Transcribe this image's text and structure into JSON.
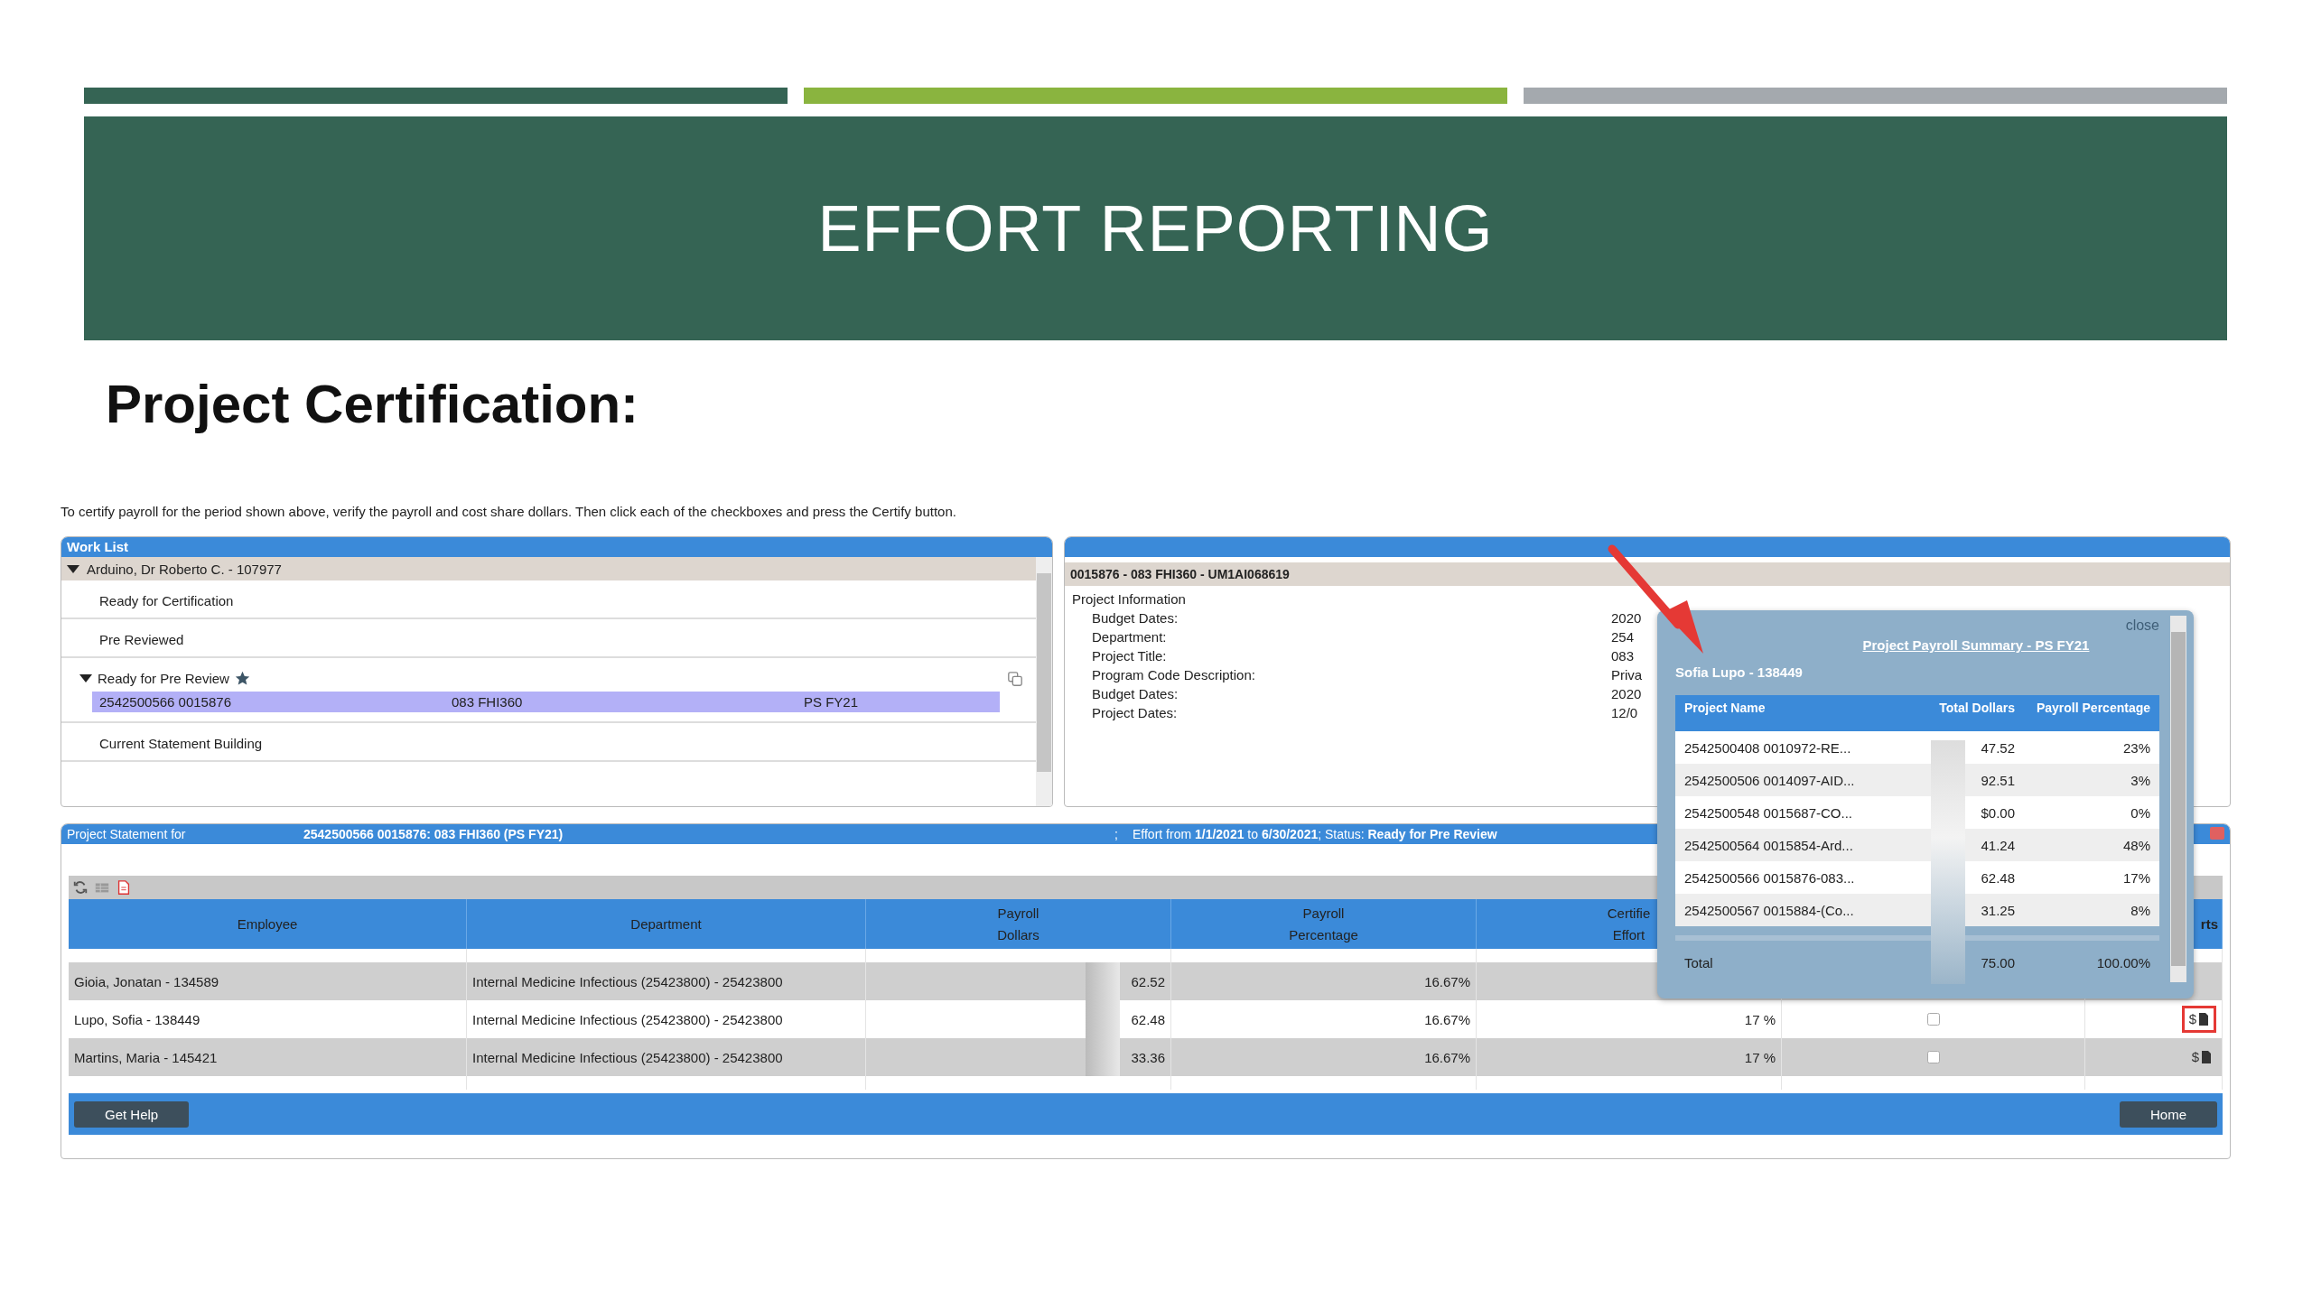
{
  "slide": {
    "title": "EFFORT REPORTING",
    "heading": "Project Certification:"
  },
  "accent_bars": [
    {
      "color": "#356454"
    },
    {
      "color": "#8ab43f"
    },
    {
      "color": "#a4a9ae"
    }
  ],
  "instructions": "To certify payroll for the period shown above, verify the payroll and cost share dollars. Then click each of the checkboxes and press the Certify button.",
  "work_list": {
    "title": "Work List",
    "tree": [
      {
        "label": "Arduino, Dr Roberto C. - 107977",
        "expanded": true,
        "children": [
          {
            "label": "Ready for Certification",
            "expanded": false,
            "starred": false
          },
          {
            "label": "Pre Reviewed",
            "expanded": false,
            "starred": false
          },
          {
            "label": "Ready for Pre Review",
            "expanded": true,
            "starred": true,
            "items": [
              {
                "cells": [
                  "2542500566 0015876",
                  "083 FHI360",
                  "PS FY21"
                ],
                "selected": true
              }
            ]
          },
          {
            "label": "Current Statement Building",
            "expanded": false,
            "starred": false
          }
        ]
      }
    ]
  },
  "project_panel": {
    "title": "0015876 - 083 FHI360 - UM1AI068619",
    "section": "Project Information",
    "fields": [
      {
        "label": "Budget Dates:",
        "value": "2020"
      },
      {
        "label": "Department:",
        "value": "254"
      },
      {
        "label": "Project Title:",
        "value": "083"
      },
      {
        "label": "Program Code Description:",
        "value": "Priva"
      },
      {
        "label": "Budget Dates:",
        "value": "2020"
      },
      {
        "label": "Project Dates:",
        "value": "12/0"
      }
    ]
  },
  "statement": {
    "label": "Project Statement for",
    "project": "2542500566 0015876: 083 FHI360 (PS FY21)",
    "separator": ";",
    "period": "Effort from **1/1/2021** to **6/30/2021**;  Status: **Ready for Pre Review**",
    "columns": [
      [
        "Employee"
      ],
      [
        "Department"
      ],
      [
        "Payroll",
        "Dollars"
      ],
      [
        "Payroll",
        "Percentage"
      ],
      [
        "Certifie",
        "Effort"
      ],
      [],
      [
        "rts"
      ]
    ],
    "rows": [
      {
        "employee": "Gioia, Jonatan - 134589",
        "department": "Internal Medicine Infectious (25423800) - 25423800",
        "dollars": "62.52",
        "percentage": "16.67%",
        "shaded": true
      },
      {
        "employee": "Lupo, Sofia - 138449",
        "department": "Internal Medicine Infectious (25423800) - 25423800",
        "dollars": "62.48",
        "percentage": "16.67%",
        "effort": "17  %",
        "checked": false,
        "report": "$",
        "highlighted": true,
        "shaded": false
      },
      {
        "employee": "Martins, Maria - 145421",
        "department": "Internal Medicine Infectious (25423800) - 25423800",
        "dollars": "33.36",
        "percentage": "16.67%",
        "effort": "17  %",
        "checked": false,
        "report": "$",
        "highlighted": false,
        "shaded": true
      }
    ],
    "buttons": [
      "Get Help",
      "Home"
    ]
  },
  "popup": {
    "close": "close",
    "title": "Project Payroll Summary - PS FY21",
    "person": "Sofia Lupo - 138449",
    "columns": [
      "Project Name",
      "Total Dollars",
      "Payroll Percentage"
    ],
    "rows": [
      {
        "name": "2542500408 0010972-RE...",
        "dollars": "47.52",
        "percentage": "23%"
      },
      {
        "name": "2542500506 0014097-AID...",
        "dollars": "92.51",
        "percentage": "3%"
      },
      {
        "name": "2542500548 0015687-CO...",
        "dollars": "$0.00",
        "percentage": "0%"
      },
      {
        "name": "2542500564 0015854-Ard...",
        "dollars": "41.24",
        "percentage": "48%"
      },
      {
        "name": "2542500566 0015876-083...",
        "dollars": "62.48",
        "percentage": "17%"
      },
      {
        "name": "2542500567 0015884-(Co...",
        "dollars": "31.25",
        "percentage": "8%"
      }
    ],
    "total": {
      "label": "Total",
      "dollars": "75.00",
      "percentage": "100.00%"
    }
  }
}
